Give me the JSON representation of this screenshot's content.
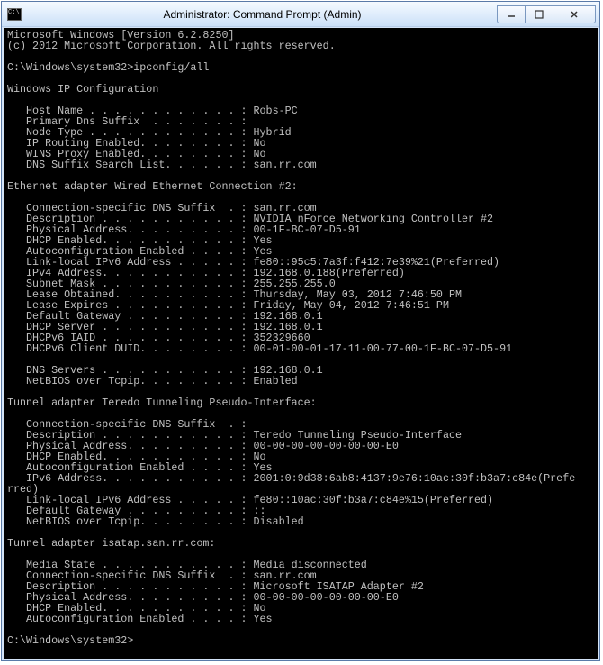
{
  "window": {
    "title": "Administrator: Command Prompt (Admin)"
  },
  "terminal": {
    "header1": "Microsoft Windows [Version 6.2.8250]",
    "header2": "(c) 2012 Microsoft Corporation. All rights reserved.",
    "prompt1": "C:\\Windows\\system32>ipconfig/all",
    "section_title": "Windows IP Configuration",
    "host_name": "   Host Name . . . . . . . . . . . . : Robs-PC",
    "primary_dns": "   Primary Dns Suffix  . . . . . . . :",
    "node_type": "   Node Type . . . . . . . . . . . . : Hybrid",
    "ip_routing": "   IP Routing Enabled. . . . . . . . : No",
    "wins_proxy": "   WINS Proxy Enabled. . . . . . . . : No",
    "dns_suffix_list": "   DNS Suffix Search List. . . . . . : san.rr.com",
    "eth_title": "Ethernet adapter Wired Ethernet Connection #2:",
    "eth_dns_suffix": "   Connection-specific DNS Suffix  . : san.rr.com",
    "eth_desc": "   Description . . . . . . . . . . . : NVIDIA nForce Networking Controller #2",
    "eth_phys": "   Physical Address. . . . . . . . . : 00-1F-BC-07-D5-91",
    "eth_dhcp": "   DHCP Enabled. . . . . . . . . . . : Yes",
    "eth_autoconf": "   Autoconfiguration Enabled . . . . : Yes",
    "eth_ll_ipv6": "   Link-local IPv6 Address . . . . . : fe80::95c5:7a3f:f412:7e39%21(Preferred)",
    "eth_ipv4": "   IPv4 Address. . . . . . . . . . . : 192.168.0.188(Preferred)",
    "eth_subnet": "   Subnet Mask . . . . . . . . . . . : 255.255.255.0",
    "eth_lease_obt": "   Lease Obtained. . . . . . . . . . : Thursday, May 03, 2012 7:46:50 PM",
    "eth_lease_exp": "   Lease Expires . . . . . . . . . . : Friday, May 04, 2012 7:46:51 PM",
    "eth_gateway": "   Default Gateway . . . . . . . . . : 192.168.0.1",
    "eth_dhcp_server": "   DHCP Server . . . . . . . . . . . : 192.168.0.1",
    "eth_dhcpv6_iaid": "   DHCPv6 IAID . . . . . . . . . . . : 352329660",
    "eth_dhcpv6_duid": "   DHCPv6 Client DUID. . . . . . . . : 00-01-00-01-17-11-00-77-00-1F-BC-07-D5-91",
    "eth_dns_servers": "   DNS Servers . . . . . . . . . . . : 192.168.0.1",
    "eth_netbios": "   NetBIOS over Tcpip. . . . . . . . : Enabled",
    "teredo_title": "Tunnel adapter Teredo Tunneling Pseudo-Interface:",
    "ter_dns_suffix": "   Connection-specific DNS Suffix  . :",
    "ter_desc": "   Description . . . . . . . . . . . : Teredo Tunneling Pseudo-Interface",
    "ter_phys": "   Physical Address. . . . . . . . . : 00-00-00-00-00-00-00-E0",
    "ter_dhcp": "   DHCP Enabled. . . . . . . . . . . : No",
    "ter_autoconf": "   Autoconfiguration Enabled . . . . : Yes",
    "ter_ipv6": "   IPv6 Address. . . . . . . . . . . : 2001:0:9d38:6ab8:4137:9e76:10ac:30f:b3a7:c84e(Prefe",
    "ter_ipv6_wrap": "rred)",
    "ter_ll_ipv6": "   Link-local IPv6 Address . . . . . : fe80::10ac:30f:b3a7:c84e%15(Preferred)",
    "ter_gateway": "   Default Gateway . . . . . . . . . : ::",
    "ter_netbios": "   NetBIOS over Tcpip. . . . . . . . : Disabled",
    "isatap_title": "Tunnel adapter isatap.san.rr.com:",
    "isa_media": "   Media State . . . . . . . . . . . : Media disconnected",
    "isa_dns_suffix": "   Connection-specific DNS Suffix  . : san.rr.com",
    "isa_desc": "   Description . . . . . . . . . . . : Microsoft ISATAP Adapter #2",
    "isa_phys": "   Physical Address. . . . . . . . . : 00-00-00-00-00-00-00-E0",
    "isa_dhcp": "   DHCP Enabled. . . . . . . . . . . : No",
    "isa_autoconf": "   Autoconfiguration Enabled . . . . : Yes",
    "prompt2": "C:\\Windows\\system32>"
  }
}
